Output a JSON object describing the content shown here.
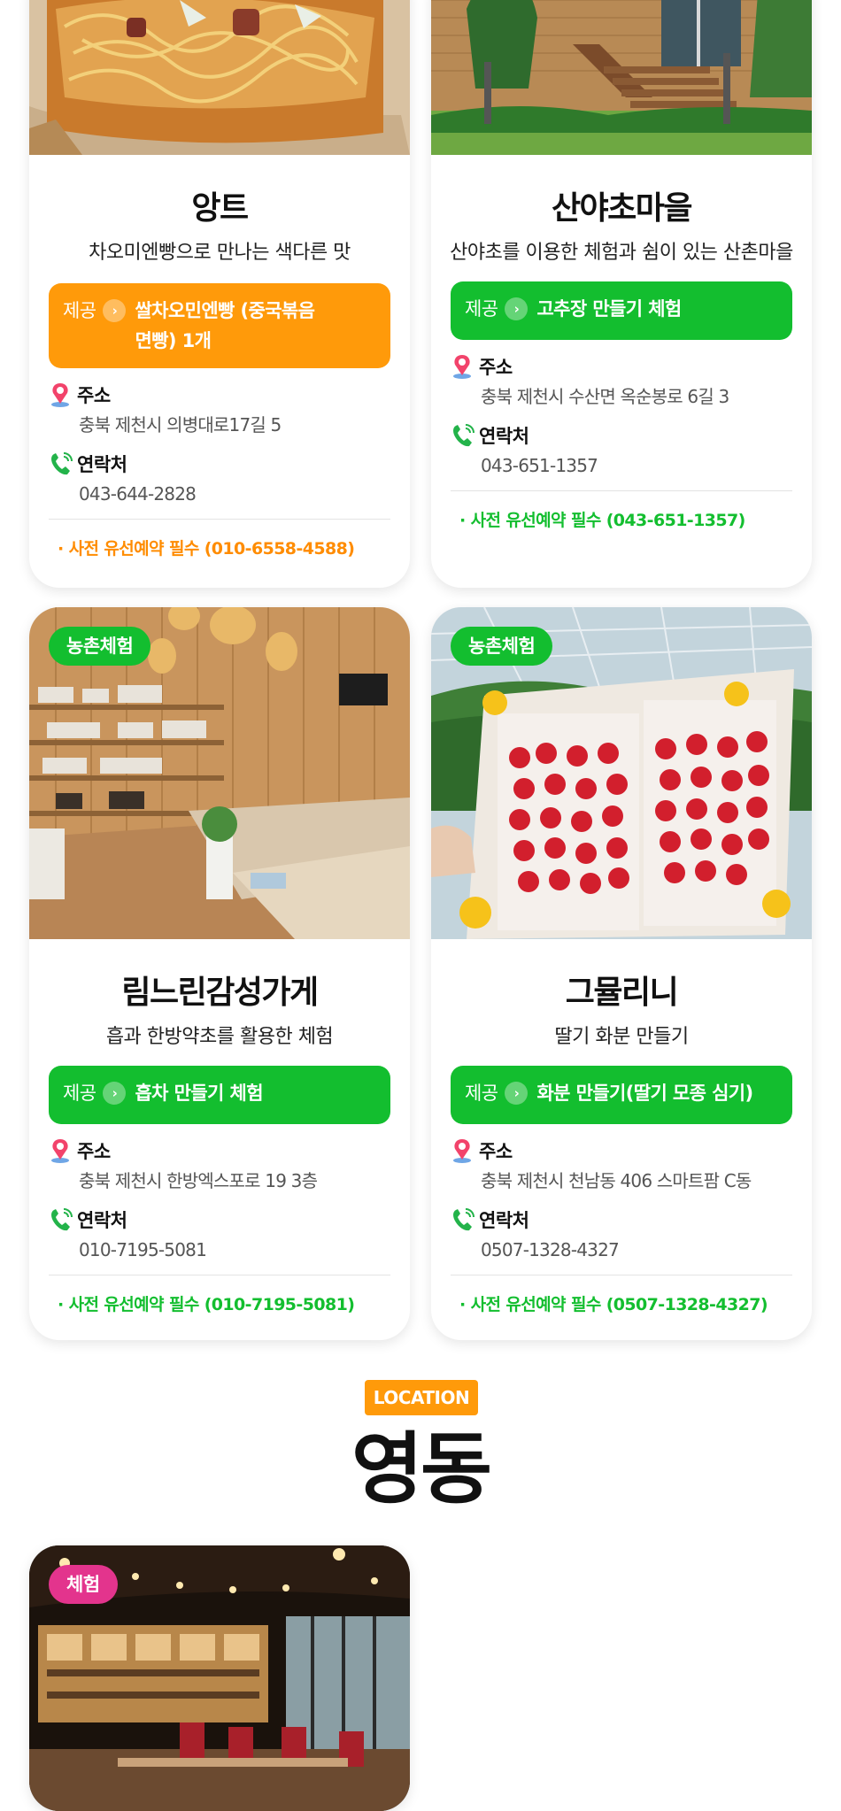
{
  "cards": [
    {
      "title": "앙트",
      "desc": "차오미엔빵으로 만나는 색다른 맛",
      "provide_label": "제공",
      "provide_text": "쌀차오민엔빵 (중국볶음면빵) 1개",
      "provide_color": "#ff9a0a",
      "address_label": "주소",
      "address": "충북 제천시 의병대로17길 5",
      "contact_label": "연락처",
      "phone": "043-644-2828",
      "notice": "· 사전 유선예약 필수 (010-6558-4588)"
    },
    {
      "title": "산야초마을",
      "desc": "산야초를 이용한 체험과 쉼이 있는 산촌마을",
      "provide_label": "제공",
      "provide_text": "고추장 만들기 체험",
      "provide_color": "#13be2f",
      "address_label": "주소",
      "address": "충북 제천시 수산면 옥순봉로 6길 3",
      "contact_label": "연락처",
      "phone": "043-651-1357",
      "notice": "· 사전 유선예약 필수 (043-651-1357)"
    },
    {
      "tag": "농촌체험",
      "title": "림느린감성가게",
      "desc": "흡과 한방약초를 활용한 체험",
      "provide_label": "제공",
      "provide_text": "흡차 만들기 체험",
      "provide_color": "#13be2f",
      "address_label": "주소",
      "address": "충북 제천시 한방엑스포로 19 3층",
      "contact_label": "연락처",
      "phone": "010-7195-5081",
      "notice": "· 사전 유선예약 필수 (010-7195-5081)"
    },
    {
      "tag": "농촌체험",
      "title": "그뮬리니",
      "desc": "딸기 화분 만들기",
      "provide_label": "제공",
      "provide_text": "화분 만들기(딸기 모종 심기)",
      "provide_color": "#13be2f",
      "address_label": "주소",
      "address": "충북 제천시 천남동 406 스마트팜 C동",
      "contact_label": "연락처",
      "phone": "0507-1328-4327",
      "notice": "· 사전 유선예약 필수 (0507-1328-4327)"
    },
    {
      "tag": "체험"
    }
  ],
  "location": {
    "badge": "LOCATION",
    "title": "영동"
  },
  "colors": {
    "orange": "#ff9a0a",
    "green": "#13be2f",
    "pink": "#e3348d"
  },
  "icons": {
    "address": "location-pin-icon",
    "contact": "phone-icon",
    "provide": "chevron-right-icon"
  }
}
